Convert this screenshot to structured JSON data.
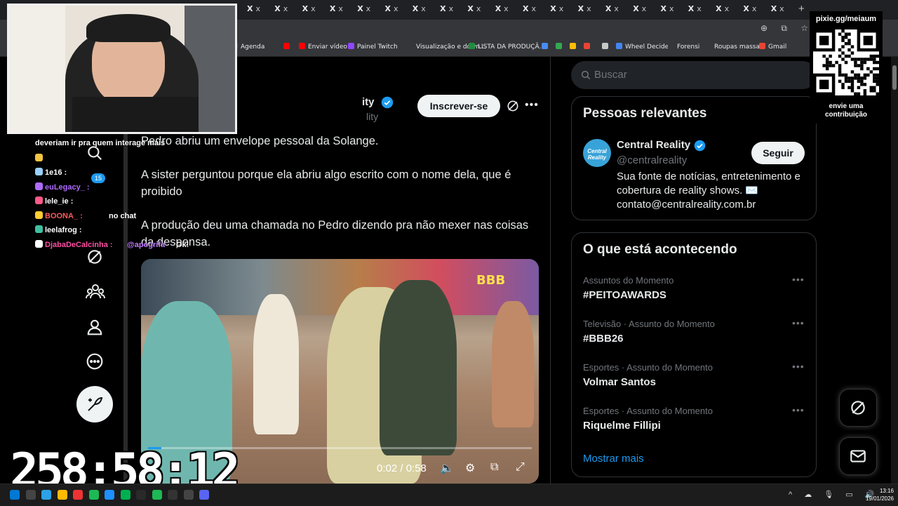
{
  "browser": {
    "tab_close_glyph": "X",
    "tab_label": "x",
    "new_tab": "+",
    "bookmarks": [
      {
        "label": "Agenda",
        "color": "#ff0000"
      },
      {
        "label": "",
        "color": "#ff0000"
      },
      {
        "label": "Enviar vídeo",
        "color": "#ff0000"
      },
      {
        "label": "Painel Twitch",
        "color": "#9146ff"
      },
      {
        "label": "Visualização e down...",
        "color": "#35363a"
      },
      {
        "label": "LISTA DA PRODUÇÃ...",
        "color": "#1e8e3e"
      },
      {
        "label": "Wheel Decide",
        "color": "#4285f4"
      },
      {
        "label": "Forensi",
        "color": "#35363a"
      },
      {
        "label": "Roupas massa",
        "color": "#35363a"
      },
      {
        "label": "Gmail",
        "color": "#ea4335"
      }
    ]
  },
  "profile": {
    "name_fragment": "ity",
    "handle_fragment": "lity",
    "subscribe_label": "Inscrever-se"
  },
  "post": {
    "paragraphs": [
      "Pedro abriu um envelope pessoal da Solange.",
      "A sister perguntou porque ela abriu algo escrito com o nome dela, que é proibido",
      "A produção deu uma chamada no Pedro dizendo pra não mexer nas coisas da despensa."
    ],
    "video": {
      "time": "0:02 / 0:58",
      "progress": 0.034,
      "watermark": "BBB"
    }
  },
  "search": {
    "placeholder": "Buscar"
  },
  "relevant": {
    "title": "Pessoas relevantes",
    "account": {
      "name": "Central Reality",
      "handle": "@centralreality",
      "bio": "Sua fonte de notícias, entretenimento e cobertura de reality shows. ✉️ contato@centralreality.com.br",
      "avatar_text": "Central Reality",
      "follow_label": "Seguir"
    }
  },
  "trends": {
    "title": "O que está acontecendo",
    "items": [
      {
        "meta": "Assuntos do Momento",
        "title": "#PEITOAWARDS"
      },
      {
        "meta": "Televisão · Assunto do Momento",
        "title": "#BBB26"
      },
      {
        "meta": "Esportes · Assunto do Momento",
        "title": "Volmar Santos"
      },
      {
        "meta": "Esportes · Assunto do Momento",
        "title": "Riquelme Fillipi"
      }
    ],
    "show_more": "Mostrar mais"
  },
  "overlay": {
    "chat": [
      {
        "text": "deveriam ir pra quem interage mais",
        "color": "#ffffff"
      },
      {
        "text": "",
        "color": "#ffffff"
      },
      {
        "text": "1e16 :",
        "color": "#ffffff"
      },
      {
        "text": "euLegacy_ :",
        "color": "#b06bff"
      },
      {
        "text": "lele_ie :",
        "color": "#ffffff"
      },
      {
        "text": "BOONA_ :",
        "color": "#ff5a5a"
      },
      {
        "text": "leelafrog :",
        "color": "#ffffff"
      },
      {
        "text": "DjabaDeCalcinha :",
        "color": "#ff4fa3"
      }
    ],
    "chat_fragments": {
      "no_chat": "no chat",
      "mention": "@apogrifa",
      "ok": "Ok!",
      "badge_count": "15"
    },
    "qr_title": "pixie.gg/meiaum",
    "qr_caption": "envie uma contribuição",
    "timer": "258:58:12"
  },
  "taskbar": {
    "time": "13:16",
    "date": "19/01/2026"
  },
  "colors": {
    "accent": "#1d9bf0",
    "verified": "#1d9bf0"
  }
}
